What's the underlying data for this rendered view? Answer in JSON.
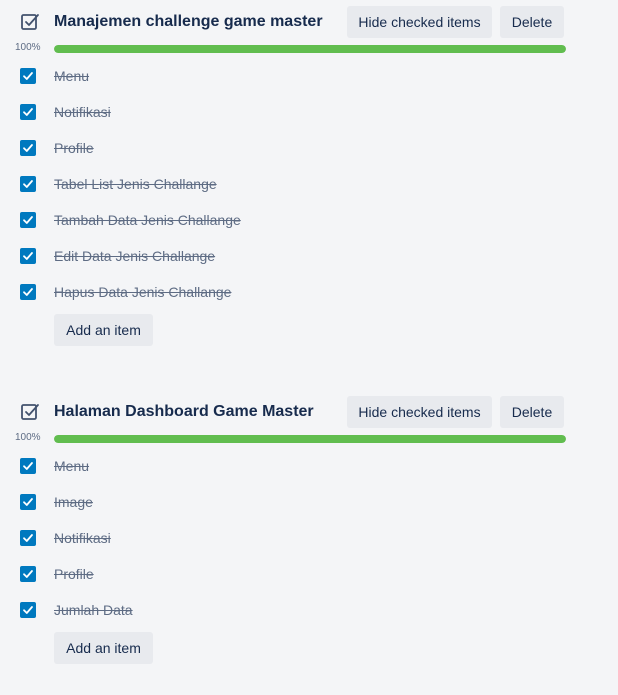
{
  "checklists": [
    {
      "title": "Manajemen challenge game master",
      "hide_checked_label": "Hide checked items",
      "delete_label": "Delete",
      "progress_label": "100%",
      "progress_value": 1.0,
      "progress_color": "#61bd4f",
      "items": [
        {
          "label": "Menu",
          "checked": true
        },
        {
          "label": "Notifikasi",
          "checked": true
        },
        {
          "label": "Profile",
          "checked": true
        },
        {
          "label": "Tabel List Jenis Challange",
          "checked": true
        },
        {
          "label": "Tambah Data Jenis Challange",
          "checked": true
        },
        {
          "label": "Edit Data Jenis Challange",
          "checked": true
        },
        {
          "label": "Hapus Data Jenis Challange",
          "checked": true
        }
      ],
      "add_item_label": "Add an item"
    },
    {
      "title": "Halaman Dashboard Game Master",
      "hide_checked_label": "Hide checked items",
      "delete_label": "Delete",
      "progress_label": "100%",
      "progress_value": 1.0,
      "progress_color": "#61bd4f",
      "items": [
        {
          "label": "Menu",
          "checked": true
        },
        {
          "label": "Image",
          "checked": true
        },
        {
          "label": "Notifikasi",
          "checked": true
        },
        {
          "label": "Profile",
          "checked": true
        },
        {
          "label": "Jumlah Data",
          "checked": true
        }
      ],
      "add_item_label": "Add an item"
    }
  ],
  "icons": {
    "checklist_title": "checklist-icon",
    "item_check": "checkmark-icon"
  },
  "colors": {
    "checkbox_fill": "#0079bf",
    "progress_fill": "#61bd4f"
  }
}
